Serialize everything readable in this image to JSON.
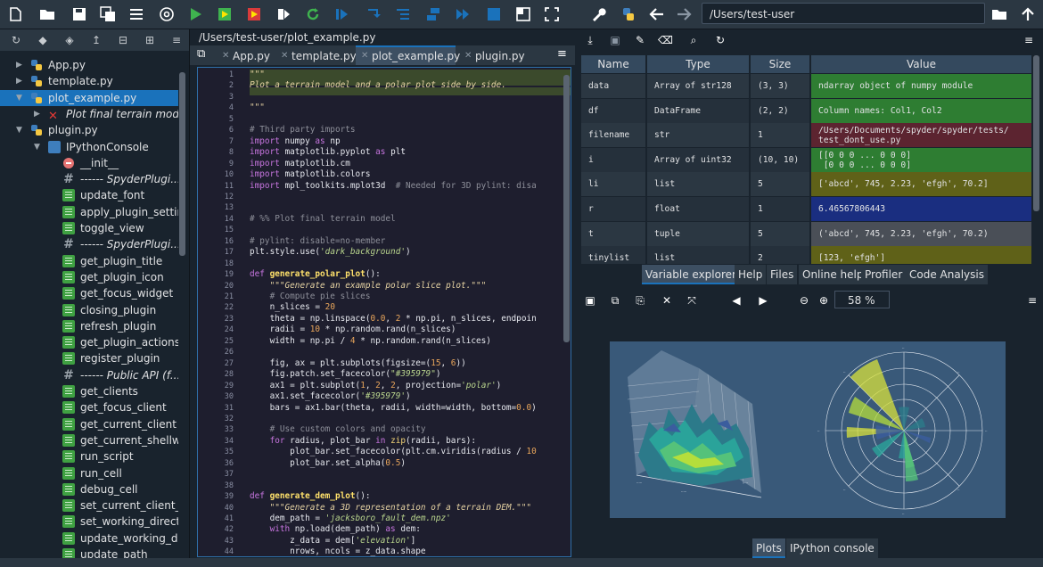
{
  "toolbar": {
    "path": "/Users/test-user",
    "accent": "#1A72BB"
  },
  "outline": {
    "items": [
      {
        "label": "App.py",
        "depth": 1,
        "icon": "python-icon"
      },
      {
        "label": "template.py",
        "depth": 1,
        "icon": "python-icon"
      },
      {
        "label": "plot_example.py",
        "depth": 1,
        "icon": "python-icon",
        "selected": true
      },
      {
        "label": "Plot final terrain model",
        "depth": 2,
        "icon": "cell-x-icon"
      },
      {
        "label": "plugin.py",
        "depth": 1,
        "icon": "python-icon"
      },
      {
        "label": "IPythonConsole",
        "depth": 2,
        "icon": "class-icon"
      },
      {
        "label": "__init__",
        "depth": 3,
        "icon": "init-icon"
      },
      {
        "label": "------ SpyderPlugi...",
        "depth": 3,
        "icon": "hash-icon"
      },
      {
        "label": "update_font",
        "depth": 3,
        "icon": "method-icon"
      },
      {
        "label": "apply_plugin_settin...",
        "depth": 3,
        "icon": "method-icon"
      },
      {
        "label": "toggle_view",
        "depth": 3,
        "icon": "method-icon"
      },
      {
        "label": "------ SpyderPlugi...",
        "depth": 3,
        "icon": "hash-icon"
      },
      {
        "label": "get_plugin_title",
        "depth": 3,
        "icon": "method-icon"
      },
      {
        "label": "get_plugin_icon",
        "depth": 3,
        "icon": "method-icon"
      },
      {
        "label": "get_focus_widget",
        "depth": 3,
        "icon": "method-icon"
      },
      {
        "label": "closing_plugin",
        "depth": 3,
        "icon": "method-icon"
      },
      {
        "label": "refresh_plugin",
        "depth": 3,
        "icon": "method-icon"
      },
      {
        "label": "get_plugin_actions",
        "depth": 3,
        "icon": "method-icon"
      },
      {
        "label": "register_plugin",
        "depth": 3,
        "icon": "method-icon"
      },
      {
        "label": "------ Public API (f...",
        "depth": 3,
        "icon": "hash-icon"
      },
      {
        "label": "get_clients",
        "depth": 3,
        "icon": "method-icon"
      },
      {
        "label": "get_focus_client",
        "depth": 3,
        "icon": "method-icon"
      },
      {
        "label": "get_current_client",
        "depth": 3,
        "icon": "method-icon"
      },
      {
        "label": "get_current_shellwi...",
        "depth": 3,
        "icon": "method-icon"
      },
      {
        "label": "run_script",
        "depth": 3,
        "icon": "method-icon"
      },
      {
        "label": "run_cell",
        "depth": 3,
        "icon": "method-icon"
      },
      {
        "label": "debug_cell",
        "depth": 3,
        "icon": "method-icon"
      },
      {
        "label": "set_current_client_...",
        "depth": 3,
        "icon": "method-icon"
      },
      {
        "label": "set_working_direct...",
        "depth": 3,
        "icon": "method-icon"
      },
      {
        "label": "update_working_dir",
        "depth": 3,
        "icon": "method-icon"
      },
      {
        "label": "update_path",
        "depth": 3,
        "icon": "method-icon"
      }
    ]
  },
  "editor": {
    "path": "/Users/test-user/plot_example.py",
    "tabs": [
      "App.py",
      "template.py",
      "plot_example.py",
      "plugin.py"
    ],
    "active_tab": 2,
    "line_numbers": [
      "1",
      "2",
      "3",
      "4",
      "5",
      "6",
      "7",
      "8",
      "9",
      "10",
      "11",
      "12",
      "13",
      "14",
      "15",
      "16",
      "17",
      "18",
      "19",
      "20",
      "21",
      "22",
      "23",
      "24",
      "25",
      "26",
      "27",
      "28",
      "29",
      "30",
      "31",
      "32",
      "33",
      "34",
      "35",
      "36",
      "37",
      "38",
      "39",
      "40",
      "41",
      "42",
      "43",
      "44"
    ],
    "lines": [
      [
        [
          "c-doc",
          "\"\"\""
        ]
      ],
      [
        [
          "c-doc",
          "Plot a terrain model and a polar plot side by side."
        ]
      ],
      [],
      [
        [
          "c-doc",
          "\"\"\""
        ]
      ],
      [],
      [
        [
          "c-cmt",
          "# Third party imports"
        ]
      ],
      [
        [
          "c-kw",
          "import"
        ],
        [
          "c-pl",
          " numpy "
        ],
        [
          "c-kw",
          "as"
        ],
        [
          "c-pl",
          " np"
        ]
      ],
      [
        [
          "c-kw",
          "import"
        ],
        [
          "c-pl",
          " matplotlib.pyplot "
        ],
        [
          "c-kw",
          "as"
        ],
        [
          "c-pl",
          " plt"
        ]
      ],
      [
        [
          "c-kw",
          "import"
        ],
        [
          "c-pl",
          " matplotlib.cm"
        ]
      ],
      [
        [
          "c-kw",
          "import"
        ],
        [
          "c-pl",
          " matplotlib.colors"
        ]
      ],
      [
        [
          "c-kw",
          "import"
        ],
        [
          "c-pl",
          " mpl_toolkits.mplot3d  "
        ],
        [
          "c-cmt",
          "# Needed for 3D pylint: disa"
        ]
      ],
      [],
      [],
      [
        [
          "c-cmt",
          "# %% Plot final terrain model"
        ]
      ],
      [],
      [
        [
          "c-cmt",
          "# pylint: disable=no-member"
        ]
      ],
      [
        [
          "c-pl",
          "plt.style.use("
        ],
        [
          "c-str",
          "'dark_background'"
        ],
        [
          "c-pl",
          ")"
        ]
      ],
      [],
      [
        [
          "c-kw",
          "def"
        ],
        [
          "c-def",
          " generate_polar_plot"
        ],
        [
          "c-pl",
          "():"
        ]
      ],
      [
        [
          "c-pl",
          "    "
        ],
        [
          "c-doc",
          "\"\"\"Generate an example polar slice plot.\"\"\""
        ]
      ],
      [
        [
          "c-pl",
          "    "
        ],
        [
          "c-cmt",
          "# Compute pie slices"
        ]
      ],
      [
        [
          "c-pl",
          "    n_slices = "
        ],
        [
          "c-num",
          "20"
        ]
      ],
      [
        [
          "c-pl",
          "    theta = np.linspace("
        ],
        [
          "c-num",
          "0.0"
        ],
        [
          "c-pl",
          ", "
        ],
        [
          "c-num",
          "2"
        ],
        [
          "c-pl",
          " * np.pi, n_slices, endpoin"
        ]
      ],
      [
        [
          "c-pl",
          "    radii = "
        ],
        [
          "c-num",
          "10"
        ],
        [
          "c-pl",
          " * np.random.rand(n_slices)"
        ]
      ],
      [
        [
          "c-pl",
          "    width = np.pi / "
        ],
        [
          "c-num",
          "4"
        ],
        [
          "c-pl",
          " * np.random.rand(n_slices)"
        ]
      ],
      [],
      [
        [
          "c-pl",
          "    fig, ax = plt.subplots(figsize=("
        ],
        [
          "c-num",
          "15"
        ],
        [
          "c-pl",
          ", "
        ],
        [
          "c-num",
          "6"
        ],
        [
          "c-pl",
          "))"
        ]
      ],
      [
        [
          "c-pl",
          "    fig.patch.set_facecolor("
        ],
        [
          "c-str",
          "\"#395979\""
        ],
        [
          "c-pl",
          ")"
        ]
      ],
      [
        [
          "c-pl",
          "    ax1 = plt.subplot("
        ],
        [
          "c-num",
          "1"
        ],
        [
          "c-pl",
          ", "
        ],
        [
          "c-num",
          "2"
        ],
        [
          "c-pl",
          ", "
        ],
        [
          "c-num",
          "2"
        ],
        [
          "c-pl",
          ", projection="
        ],
        [
          "c-str",
          "'polar'"
        ],
        [
          "c-pl",
          ")"
        ]
      ],
      [
        [
          "c-pl",
          "    ax1.set_facecolor("
        ],
        [
          "c-str",
          "'#395979'"
        ],
        [
          "c-pl",
          ")"
        ]
      ],
      [
        [
          "c-pl",
          "    bars = ax1.bar(theta, radii, width=width, bottom="
        ],
        [
          "c-num",
          "0.0"
        ],
        [
          "c-pl",
          ")"
        ]
      ],
      [],
      [
        [
          "c-pl",
          "    "
        ],
        [
          "c-cmt",
          "# Use custom colors and opacity"
        ]
      ],
      [
        [
          "c-pl",
          "    "
        ],
        [
          "c-kw",
          "for"
        ],
        [
          "c-pl",
          " radius, plot_bar "
        ],
        [
          "c-kw",
          "in"
        ],
        [
          "c-fn",
          " zip"
        ],
        [
          "c-pl",
          "(radii, bars):"
        ]
      ],
      [
        [
          "c-pl",
          "        plot_bar.set_facecolor(plt.cm.viridis(radius / "
        ],
        [
          "c-num",
          "10"
        ]
      ],
      [
        [
          "c-pl",
          "        plot_bar.set_alpha("
        ],
        [
          "c-num",
          "0.5"
        ],
        [
          "c-pl",
          ")"
        ]
      ],
      [],
      [],
      [
        [
          "c-kw",
          "def"
        ],
        [
          "c-def",
          " generate_dem_plot"
        ],
        [
          "c-pl",
          "():"
        ]
      ],
      [
        [
          "c-pl",
          "    "
        ],
        [
          "c-doc",
          "\"\"\"Generate a 3D representation of a terrain DEM.\"\"\""
        ]
      ],
      [
        [
          "c-pl",
          "    dem_path = "
        ],
        [
          "c-str",
          "'jacksboro_fault_dem.npz'"
        ]
      ],
      [
        [
          "c-pl",
          "    "
        ],
        [
          "c-kw",
          "with"
        ],
        [
          "c-pl",
          " np.load(dem_path) "
        ],
        [
          "c-kw",
          "as"
        ],
        [
          "c-pl",
          " dem:"
        ]
      ],
      [
        [
          "c-pl",
          "        z_data = dem["
        ],
        [
          "c-str",
          "'elevation'"
        ],
        [
          "c-pl",
          "]"
        ]
      ],
      [
        [
          "c-pl",
          "        nrows, ncols = z_data.shape"
        ]
      ]
    ]
  },
  "variables": {
    "headers": [
      "Name",
      "Type",
      "Size",
      "Value"
    ],
    "rows": [
      {
        "name": "data",
        "type": "Array of str128",
        "size": "(3, 3)",
        "value": "ndarray object of numpy module",
        "color": "#2E7D32"
      },
      {
        "name": "df",
        "type": "DataFrame",
        "size": "(2, 2)",
        "value": "Column names: Col1, Col2",
        "color": "#2E7D32"
      },
      {
        "name": "filename",
        "type": "str",
        "size": "1",
        "value": "/Users/Documents/spyder/spyder/tests/\ntest_dont_use.py",
        "color": "#5C2430"
      },
      {
        "name": "i",
        "type": "Array of uint32",
        "size": "(10, 10)",
        "value": "[[0 0 0 ... 0 0 0]\n [0 0 0 ... 0 0 0]",
        "color": "#2E7D32"
      },
      {
        "name": "li",
        "type": "list",
        "size": "5",
        "value": "['abcd', 745, 2.23, 'efgh', 70.2]",
        "color": "#5F6118"
      },
      {
        "name": "r",
        "type": "float",
        "size": "1",
        "value": "6.46567806443",
        "color": "#1A2E80"
      },
      {
        "name": "t",
        "type": "tuple",
        "size": "5",
        "value": "('abcd', 745, 2.23, 'efgh', 70.2)",
        "color": "#4A4F57"
      },
      {
        "name": "tinylist",
        "type": "list",
        "size": "2",
        "value": "[123, 'efgh']",
        "color": "#5F6118"
      }
    ]
  },
  "pane_tabs": [
    "Variable explorer",
    "Help",
    "Files",
    "Online help",
    "Profiler",
    "Code Analysis"
  ],
  "plots": {
    "zoom": "58 %",
    "figure_bg": "#395979"
  },
  "bottom_tabs": [
    "Plots",
    "IPython console"
  ]
}
